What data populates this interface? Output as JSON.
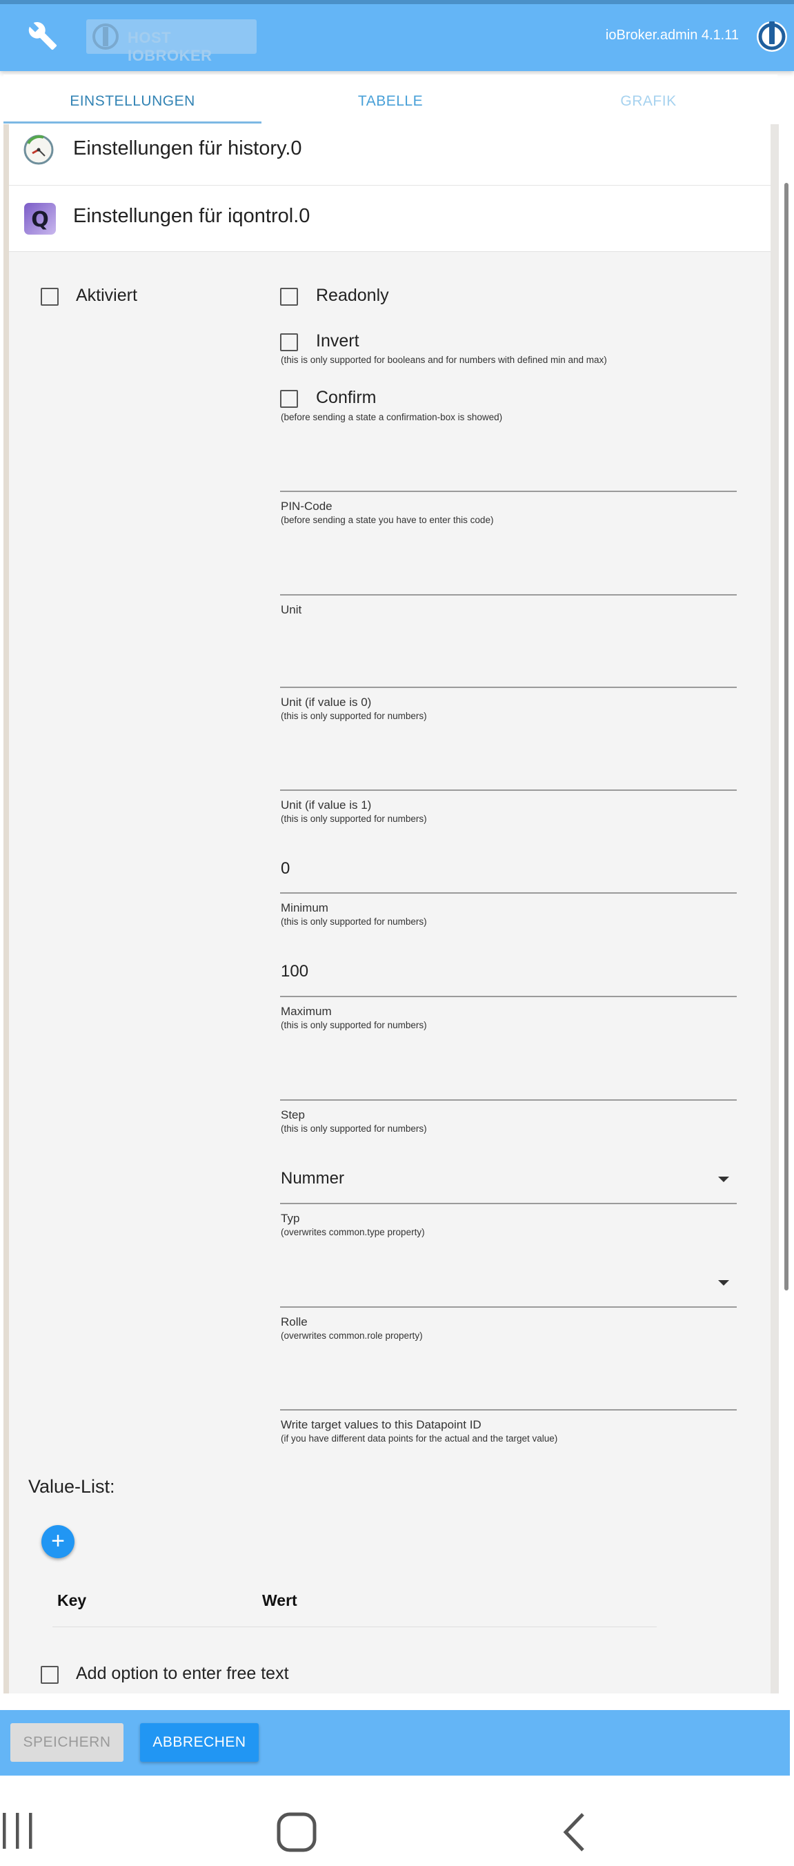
{
  "header": {
    "host_label": "HOST IOBROKER",
    "version": "ioBroker.admin 4.1.11",
    "icons": [
      "wrench-icon",
      "iobroker-logo-icon"
    ]
  },
  "tabs": [
    {
      "label": "EINSTELLUNGEN",
      "active": true
    },
    {
      "label": "TABELLE",
      "active": false
    },
    {
      "label": "GRAFIK",
      "active": false
    }
  ],
  "adapters": [
    {
      "label": "Einstellungen für history.0",
      "icon": "history-clock-icon"
    },
    {
      "label": "Einstellungen für iqontrol.0",
      "icon": "iqontrol-q-icon"
    }
  ],
  "settings": {
    "enabled_label": "Aktiviert",
    "readonly_label": "Readonly",
    "invert_label": "Invert",
    "invert_help": "(this is only supported for booleans and for numbers with defined min and max)",
    "confirm_label": "Confirm",
    "confirm_help": "(before sending a state a confirmation-box is showed)",
    "fields": [
      {
        "label": "PIN-Code",
        "help": "(before sending a state you have to enter this code)",
        "value": ""
      },
      {
        "label": "Unit",
        "help": "",
        "value": ""
      },
      {
        "label": "Unit (if value is 0)",
        "help": "(this is only supported for numbers)",
        "value": ""
      },
      {
        "label": "Unit (if value is 1)",
        "help": "(this is only supported for numbers)",
        "value": ""
      },
      {
        "label": "Minimum",
        "help": "(this is only supported for numbers)",
        "value": "0"
      },
      {
        "label": "Maximum",
        "help": "(this is only supported for numbers)",
        "value": "100"
      },
      {
        "label": "Step",
        "help": "(this is only supported for numbers)",
        "value": ""
      },
      {
        "label": "Typ",
        "help": "(overwrites common.type property)",
        "value": "Nummer"
      },
      {
        "label": "Rolle",
        "help": "(overwrites common.role property)",
        "value": ""
      },
      {
        "label": "Write target values to this Datapoint ID",
        "help": "(if you have different data points for the actual and the target value)",
        "value": ""
      }
    ],
    "value_list_title": "Value-List:",
    "table_headers": [
      "Key",
      "Wert"
    ],
    "free_text_label": "Add option to enter free text"
  },
  "actions": {
    "save": "SPEICHERN",
    "cancel": "ABBRECHEN"
  },
  "colors": {
    "appbar": "#64b5f6",
    "primary": "#2196f3",
    "panel": "#f4f4f4"
  }
}
